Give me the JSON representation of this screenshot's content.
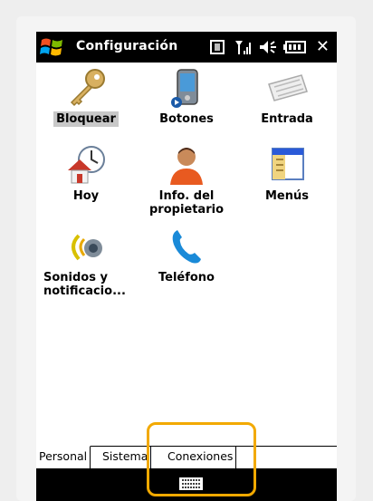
{
  "titlebar": {
    "title": "Configuración",
    "close": "✕",
    "icons": [
      "windows-flag-icon",
      "storage-card-icon",
      "signal-icon",
      "volume-icon",
      "battery-icon",
      "close-icon"
    ]
  },
  "items": [
    {
      "label": "Bloquear",
      "icon": "key-icon",
      "selected": true
    },
    {
      "label": "Botones",
      "icon": "device-buttons-icon"
    },
    {
      "label": "Entrada",
      "icon": "keyboard-icon"
    },
    {
      "label": "Hoy",
      "icon": "today-clock-house-icon"
    },
    {
      "label": "Info. del propietario",
      "icon": "owner-person-icon"
    },
    {
      "label": "Menús",
      "icon": "menus-window-icon"
    },
    {
      "label": "Sonidos y notificacio...",
      "icon": "sound-notification-icon"
    },
    {
      "label": "Teléfono",
      "icon": "phone-handset-icon"
    }
  ],
  "tabs": [
    {
      "label": "Personal",
      "active": true
    },
    {
      "label": "Sistema"
    },
    {
      "label": "Conexiones"
    }
  ],
  "bottombar": {
    "icon": "keyboard-sip-icon"
  },
  "colors": {
    "highlight": "#f2a900",
    "bar": "#000000"
  }
}
